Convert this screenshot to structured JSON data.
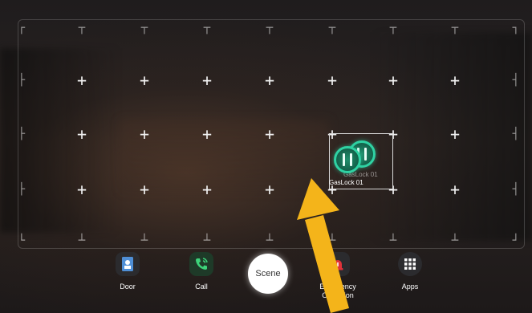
{
  "widget": {
    "label_ghost": "GasLock 01",
    "label": "GasLock 01",
    "icon": "gas-valve-icon",
    "accent": "#2fd2a3"
  },
  "dock": {
    "door_label": "Door",
    "call_label": "Call",
    "scene_label": "Scene",
    "emergency_label_line1": "Emergency",
    "emergency_label_line2": "Operation",
    "apps_label": "Apps"
  },
  "colors": {
    "door_accent": "#4f8fd6",
    "call_accent": "#3dd37a",
    "emergency_accent": "#e0323a",
    "arrow": "#f4b41a"
  }
}
